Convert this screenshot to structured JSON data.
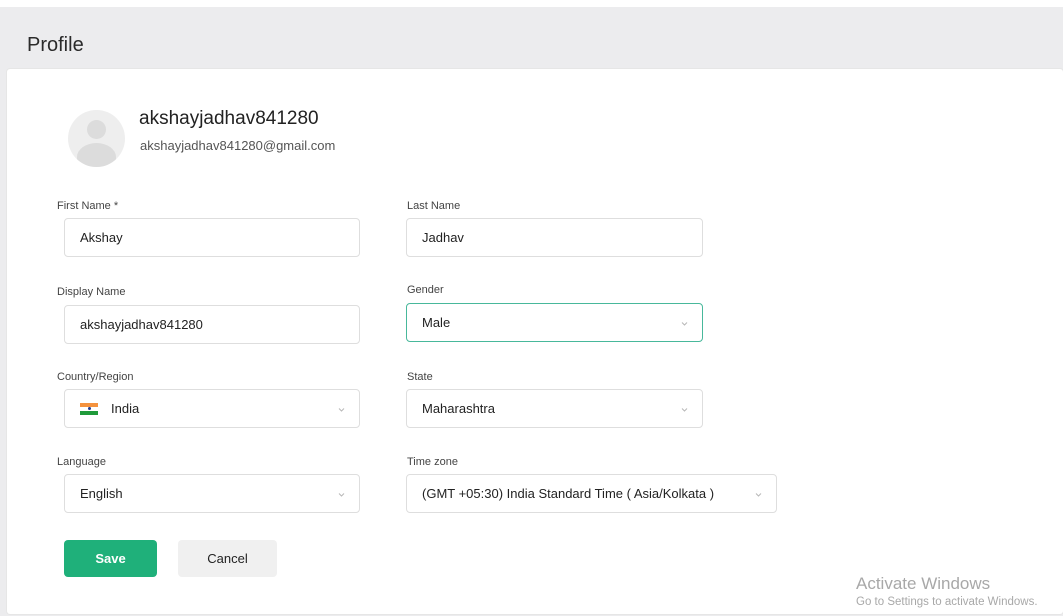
{
  "page": {
    "title": "Profile"
  },
  "user": {
    "username": "akshayjadhav841280",
    "email": "akshayjadhav841280@gmail.com"
  },
  "form": {
    "first_name": {
      "label": "First Name",
      "required_mark": "*",
      "value": "Akshay"
    },
    "last_name": {
      "label": "Last Name",
      "value": "Jadhav"
    },
    "display_name": {
      "label": "Display Name",
      "value": "akshayjadhav841280"
    },
    "gender": {
      "label": "Gender",
      "value": "Male"
    },
    "country": {
      "label": "Country/Region",
      "value": "India",
      "flag_icon": "india-flag-icon"
    },
    "state": {
      "label": "State",
      "value": "Maharashtra"
    },
    "language": {
      "label": "Language",
      "value": "English"
    },
    "timezone": {
      "label": "Time zone",
      "value": "(GMT +05:30) India Standard Time ( Asia/Kolkata )"
    }
  },
  "actions": {
    "save_label": "Save",
    "cancel_label": "Cancel"
  },
  "watermark": {
    "line1": "Activate Windows",
    "line2": "Go to Settings to activate Windows."
  },
  "colors": {
    "primary": "#1fb07a",
    "focus_border": "#48b89b",
    "background": "#ececee"
  }
}
